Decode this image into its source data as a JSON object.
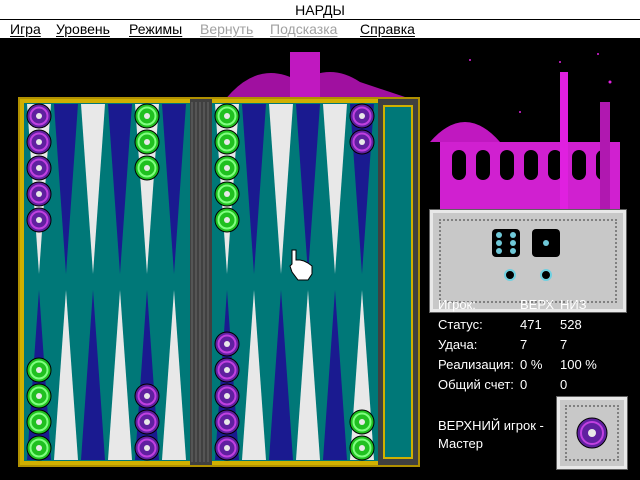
{
  "window": {
    "title": "НАРДЫ"
  },
  "menu": [
    {
      "label": "Игра",
      "enabled": true
    },
    {
      "label": "Уровень",
      "enabled": true
    },
    {
      "label": "Режимы",
      "enabled": true
    },
    {
      "label": "Вернуть",
      "enabled": false
    },
    {
      "label": "Подсказка",
      "enabled": false
    },
    {
      "label": "Справка",
      "enabled": true
    }
  ],
  "dice": {
    "values": [
      6,
      1
    ]
  },
  "stats": {
    "header": {
      "label": "Игрок:",
      "top": "ВЕРХ",
      "bottom": "НИЗ"
    },
    "status": {
      "label": "Статус:",
      "top": "471",
      "bottom": "528"
    },
    "luck": {
      "label": "Удача:",
      "top": "7",
      "bottom": "7"
    },
    "realization": {
      "label": "Реализация:",
      "top": "0 %",
      "bottom": "100 %"
    },
    "score": {
      "label": "Общий счет:",
      "top": "0",
      "bottom": "0"
    }
  },
  "status_message": {
    "line1": "ВЕРХНИЙ игрок -",
    "line2": "Мастер"
  },
  "colors": {
    "felt": "#007878",
    "frame": "#c0a000",
    "bar": "#505050",
    "green_checker": "#20c020",
    "purple_checker": "#6020a0",
    "magenta_bg": "#e020e0",
    "dice_panel": "#c8c8c8"
  },
  "board": {
    "top_points": [
      {
        "point": 1,
        "color": "purple",
        "count": 5
      },
      {
        "point": 2,
        "color": "",
        "count": 0
      },
      {
        "point": 3,
        "color": "",
        "count": 0
      },
      {
        "point": 4,
        "color": "",
        "count": 0
      },
      {
        "point": 5,
        "color": "green",
        "count": 3
      },
      {
        "point": 6,
        "color": "",
        "count": 0
      },
      {
        "point": 7,
        "color": "green",
        "count": 5
      },
      {
        "point": 8,
        "color": "",
        "count": 0
      },
      {
        "point": 9,
        "color": "",
        "count": 0
      },
      {
        "point": 10,
        "color": "",
        "count": 0
      },
      {
        "point": 11,
        "color": "",
        "count": 0
      },
      {
        "point": 12,
        "color": "purple",
        "count": 2
      }
    ],
    "bottom_points": [
      {
        "point": 1,
        "color": "green",
        "count": 4
      },
      {
        "point": 2,
        "color": "",
        "count": 0
      },
      {
        "point": 3,
        "color": "",
        "count": 0
      },
      {
        "point": 4,
        "color": "",
        "count": 0
      },
      {
        "point": 5,
        "color": "purple",
        "count": 3
      },
      {
        "point": 6,
        "color": "",
        "count": 0
      },
      {
        "point": 7,
        "color": "purple",
        "count": 5
      },
      {
        "point": 8,
        "color": "",
        "count": 0
      },
      {
        "point": 9,
        "color": "",
        "count": 0
      },
      {
        "point": 10,
        "color": "",
        "count": 0
      },
      {
        "point": 11,
        "color": "",
        "count": 0
      },
      {
        "point": 12,
        "color": "green",
        "count": 2
      }
    ],
    "side_chip": "purple"
  }
}
